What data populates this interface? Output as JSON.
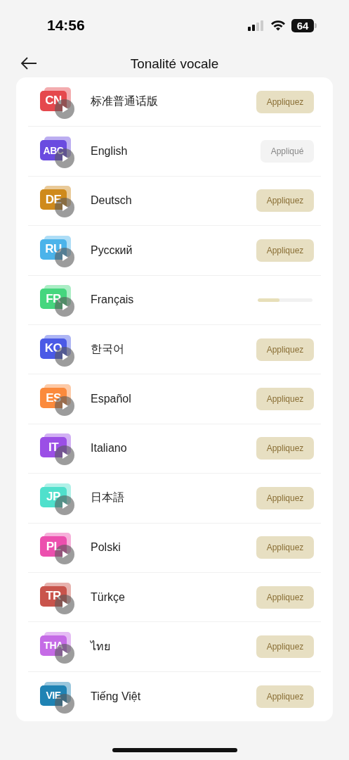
{
  "status_bar": {
    "time": "14:56",
    "battery": "64"
  },
  "header": {
    "title": "Tonalité vocale"
  },
  "languages": [
    {
      "badge": "CN",
      "name": "标准普通话版",
      "color": "#e5484d",
      "kind": "apply",
      "action": "Appliquez"
    },
    {
      "badge": "ABC",
      "name": "English",
      "color": "#6a4be0",
      "kind": "applied",
      "action": "Appliqué"
    },
    {
      "badge": "DE",
      "name": "Deutsch",
      "color": "#cf8a1c",
      "kind": "apply",
      "action": "Appliquez"
    },
    {
      "badge": "RU",
      "name": "Русский",
      "color": "#4bb3ea",
      "kind": "apply",
      "action": "Appliquez"
    },
    {
      "badge": "FR",
      "name": "Français",
      "color": "#45d67e",
      "kind": "downloading",
      "level": 0.4
    },
    {
      "badge": "KO",
      "name": "한국어",
      "color": "#4a5ae6",
      "kind": "apply",
      "action": "Appliquez"
    },
    {
      "badge": "ES",
      "name": "Español",
      "color": "#fb8a3c",
      "kind": "apply",
      "action": "Appliquez"
    },
    {
      "badge": "IT",
      "name": "Italiano",
      "color": "#9b4fe6",
      "kind": "apply",
      "action": "Appliquez"
    },
    {
      "badge": "JP",
      "name": "日本語",
      "color": "#4fe0cc",
      "kind": "apply",
      "action": "Appliquez"
    },
    {
      "badge": "PL",
      "name": "Polski",
      "color": "#ec4fae",
      "kind": "apply",
      "action": "Appliquez"
    },
    {
      "badge": "TR",
      "name": "Türkçe",
      "color": "#c9544c",
      "kind": "apply",
      "action": "Appliquez"
    },
    {
      "badge": "THA",
      "name": "ไทย",
      "color": "#c56be6",
      "kind": "apply",
      "action": "Appliquez"
    },
    {
      "badge": "VIE",
      "name": "Tiếng Việt",
      "color": "#1f83b4",
      "kind": "apply",
      "action": "Appliquez"
    }
  ]
}
